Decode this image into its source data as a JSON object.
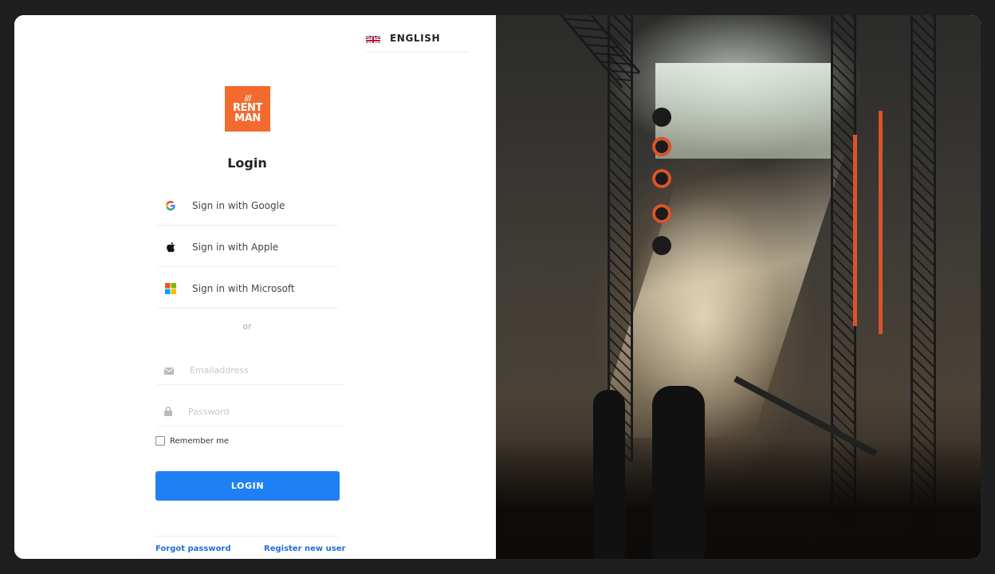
{
  "language": {
    "label": "ENGLISH"
  },
  "logo": {
    "top": "RENT",
    "bottom": "MAN",
    "color": "#f26a2e"
  },
  "page_title": "Login",
  "sso": [
    {
      "label": "Sign in with Google",
      "icon": "google-icon"
    },
    {
      "label": "Sign in with Apple",
      "icon": "apple-icon"
    },
    {
      "label": "Sign in with Microsoft",
      "icon": "microsoft-icon"
    }
  ],
  "divider_text": "or",
  "fields": {
    "email": {
      "placeholder": "Emailaddress",
      "value": ""
    },
    "password": {
      "placeholder": "Password",
      "value": ""
    }
  },
  "remember_me": {
    "label": "Remember me",
    "checked": false
  },
  "login_button": {
    "label": "LOGIN",
    "color": "#1f80f5"
  },
  "links": {
    "forgot": "Forgot password",
    "register": "Register new user"
  }
}
